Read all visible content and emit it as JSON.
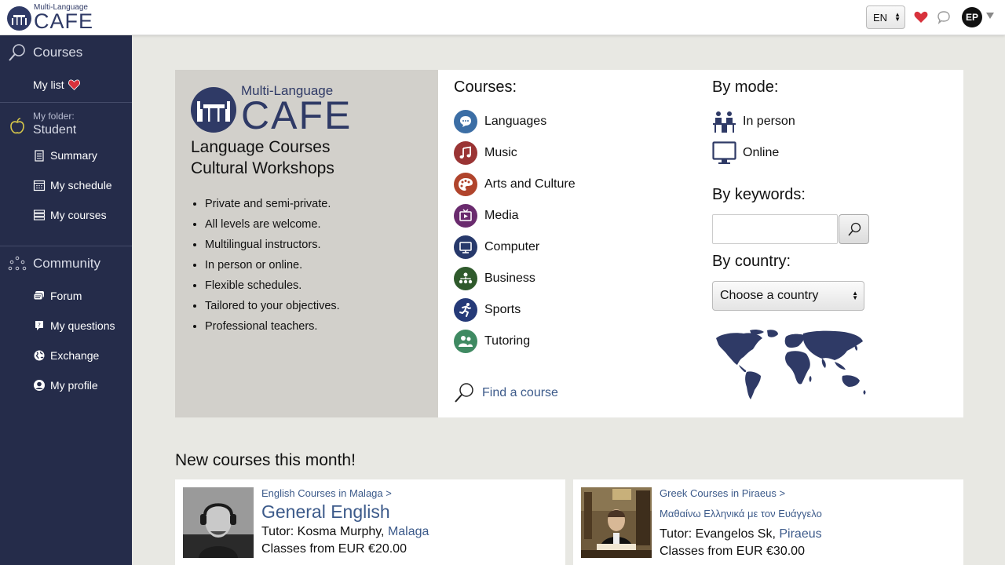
{
  "header": {
    "logo_small": "Multi-Language",
    "logo_big": "CAFE",
    "language": "EN",
    "avatar_initials": "EP"
  },
  "sidebar": {
    "courses_label": "Courses",
    "my_list_label": "My list",
    "folder_label": "My folder:",
    "folder_name": "Student",
    "summary_label": "Summary",
    "schedule_label": "My schedule",
    "my_courses_label": "My courses",
    "community_label": "Community",
    "forum_label": "Forum",
    "questions_label": "My questions",
    "exchange_label": "Exchange",
    "profile_label": "My profile"
  },
  "hero": {
    "logo_small": "Multi-Language",
    "logo_big": "CAFE",
    "tagline1": "Language Courses",
    "tagline2": "Cultural Workshops",
    "bullets": [
      "Private and semi-private.",
      "All levels are welcome.",
      "Multilingual instructors.",
      "In person or online.",
      "Flexible schedules.",
      "Tailored to your objectives.",
      "Professional teachers."
    ]
  },
  "courses": {
    "title": "Courses:",
    "categories": [
      {
        "label": "Languages",
        "color": "#3c6ea5"
      },
      {
        "label": "Music",
        "color": "#9a3434"
      },
      {
        "label": "Arts and Culture",
        "color": "#b0442c"
      },
      {
        "label": "Media",
        "color": "#6a2b6e"
      },
      {
        "label": "Computer",
        "color": "#27396b"
      },
      {
        "label": "Business",
        "color": "#2f5a2c"
      },
      {
        "label": "Sports",
        "color": "#253a78"
      },
      {
        "label": "Tutoring",
        "color": "#3f8a62"
      }
    ],
    "find_label": "Find a course"
  },
  "filters": {
    "mode_title": "By mode:",
    "in_person": "In person",
    "online": "Online",
    "keywords_title": "By keywords:",
    "keywords_value": "",
    "country_title": "By country:",
    "country_selected": "Choose a country"
  },
  "new_courses": {
    "title": "New courses this month!",
    "cards": [
      {
        "crumb": "English Courses in Malaga >",
        "title": "General English",
        "tutor_prefix": "Tutor: Kosma Murphy,",
        "city": "Malaga",
        "price": "Classes from EUR €20.00"
      },
      {
        "crumb": "Greek Courses in Piraeus >",
        "subtitle": "Μαθαίνω Ελληνικά με τον Ευάγγελο",
        "tutor_prefix": "Tutor: Evangelos Sk,",
        "city": "Piraeus",
        "price": "Classes from EUR €30.00"
      }
    ]
  },
  "colors": {
    "sidebar_bg": "#252c4a",
    "brand": "#2f3a66",
    "link": "#3c5a8a",
    "heart": "#d8323c"
  }
}
